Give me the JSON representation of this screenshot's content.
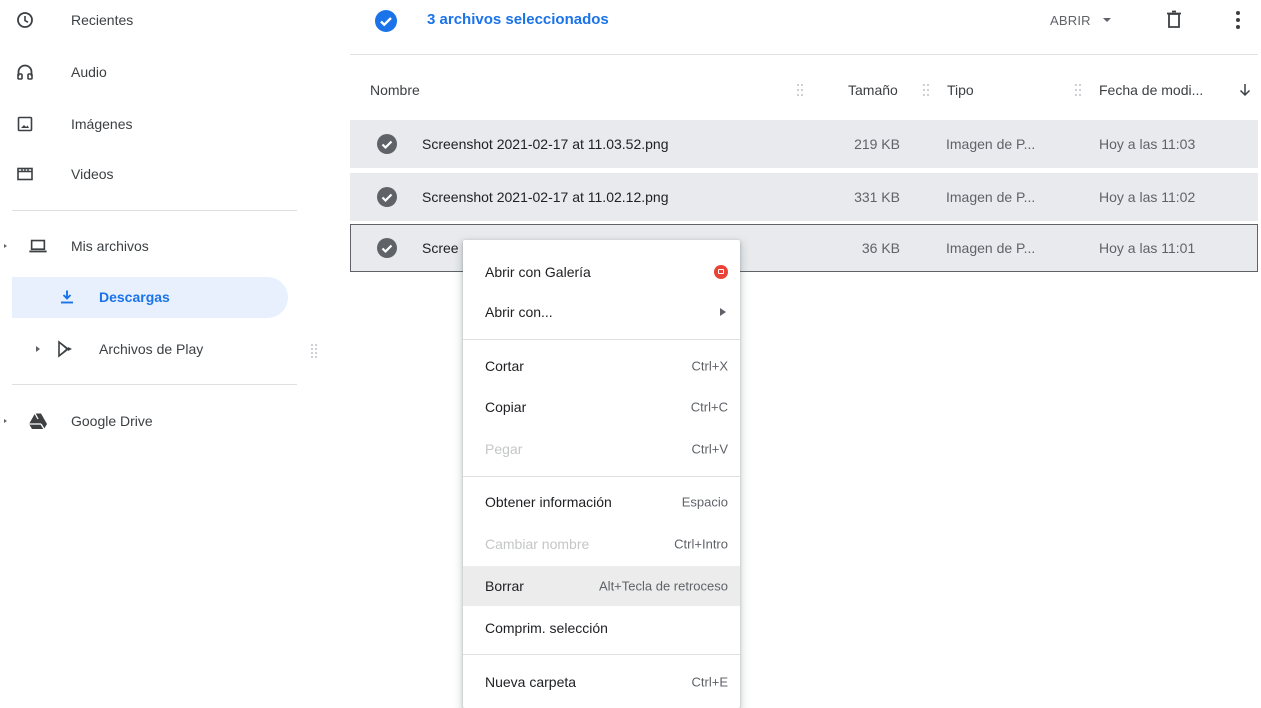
{
  "sidebar": {
    "items": [
      {
        "label": "Recientes",
        "icon": "clock-icon"
      },
      {
        "label": "Audio",
        "icon": "headphones-icon"
      },
      {
        "label": "Imágenes",
        "icon": "image-icon"
      },
      {
        "label": "Videos",
        "icon": "film-icon"
      },
      {
        "label": "Mis archivos",
        "icon": "laptop-icon"
      },
      {
        "label": "Descargas",
        "icon": "download-icon",
        "active": true
      },
      {
        "label": "Archivos de Play",
        "icon": "play-store-icon"
      },
      {
        "label": "Google Drive",
        "icon": "google-drive-icon"
      }
    ]
  },
  "header": {
    "selection_text": "3 archivos seleccionados",
    "open_label": "ABRIR"
  },
  "columns": {
    "name": "Nombre",
    "size": "Tamaño",
    "type": "Tipo",
    "date": "Fecha de modi..."
  },
  "files": [
    {
      "name": "Screenshot 2021-02-17 at 11.03.52.png",
      "size": "219 KB",
      "type": "Imagen de P...",
      "date": "Hoy a las 11:03"
    },
    {
      "name": "Screenshot 2021-02-17 at 11.02.12.png",
      "size": "331 KB",
      "type": "Imagen de P...",
      "date": "Hoy a las 11:02"
    },
    {
      "name": "Scree",
      "size": "36 KB",
      "type": "Imagen de P...",
      "date": "Hoy a las 11:01"
    }
  ],
  "context_menu": {
    "open_with_gallery": "Abrir con Galería",
    "open_with": "Abrir con...",
    "cut": "Cortar",
    "cut_sc": "Ctrl+X",
    "copy": "Copiar",
    "copy_sc": "Ctrl+C",
    "paste": "Pegar",
    "paste_sc": "Ctrl+V",
    "info": "Obtener información",
    "info_sc": "Espacio",
    "rename": "Cambiar nombre",
    "rename_sc": "Ctrl+Intro",
    "delete": "Borrar",
    "delete_sc": "Alt+Tecla de retroceso",
    "zip": "Comprim. selección",
    "new_folder": "Nueva carpeta",
    "new_folder_sc": "Ctrl+E"
  },
  "colors": {
    "accent": "#1a73e8",
    "selected_row": "#e8eaed",
    "active_nav": "#e8f0fe",
    "gallery_badge": "#ea4335"
  }
}
